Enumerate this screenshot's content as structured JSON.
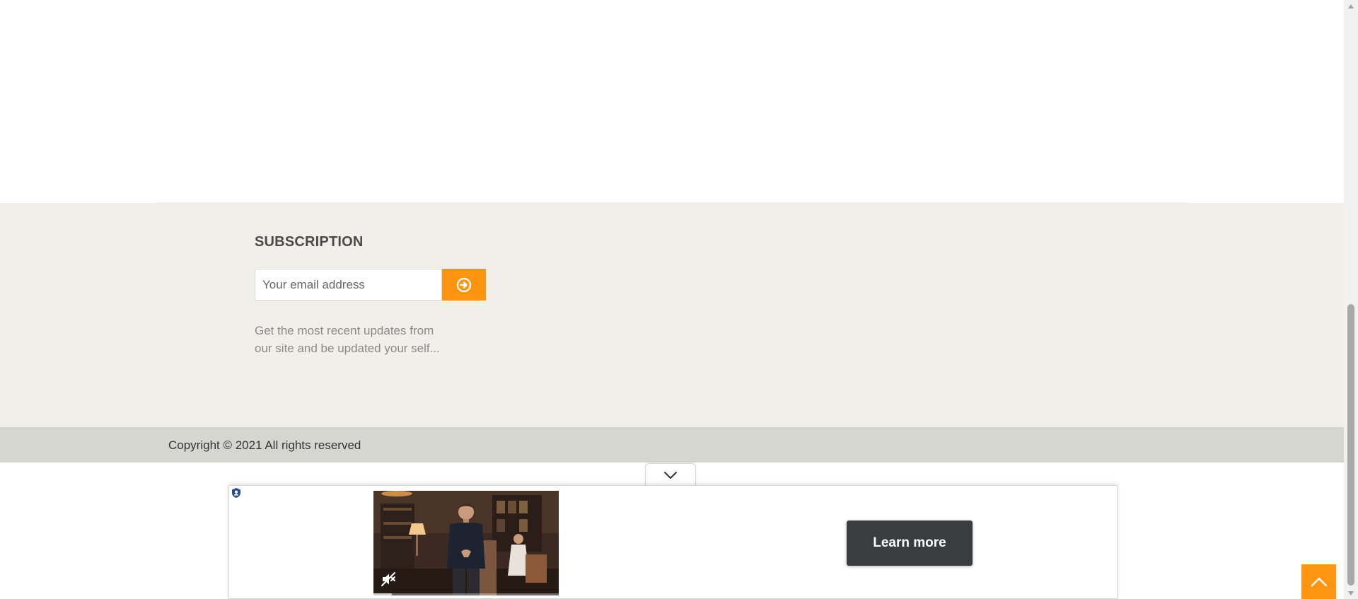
{
  "subscription": {
    "title": "SUBSCRIPTION",
    "email_placeholder": "Your email address",
    "submit_icon": "arrow-circle-right-icon",
    "description_line1": "Get the most recent updates from",
    "description_line2": "our site and be updated your self..."
  },
  "footer": {
    "copyright": "Copyright © 2021 All rights reserved"
  },
  "ad": {
    "collapse_icon": "chevron-down-icon",
    "badge_icon": "shield-user-icon",
    "mute_icon": "speaker-muted-icon",
    "progress": 0.1,
    "cta_label": "Learn more"
  },
  "back_to_top_icon": "chevron-up-icon",
  "colors": {
    "accent": "#ff9411",
    "subscription_bg": "#f0efea",
    "copyright_bg": "#d6d6d1",
    "cta_bg": "#3a3d40"
  }
}
